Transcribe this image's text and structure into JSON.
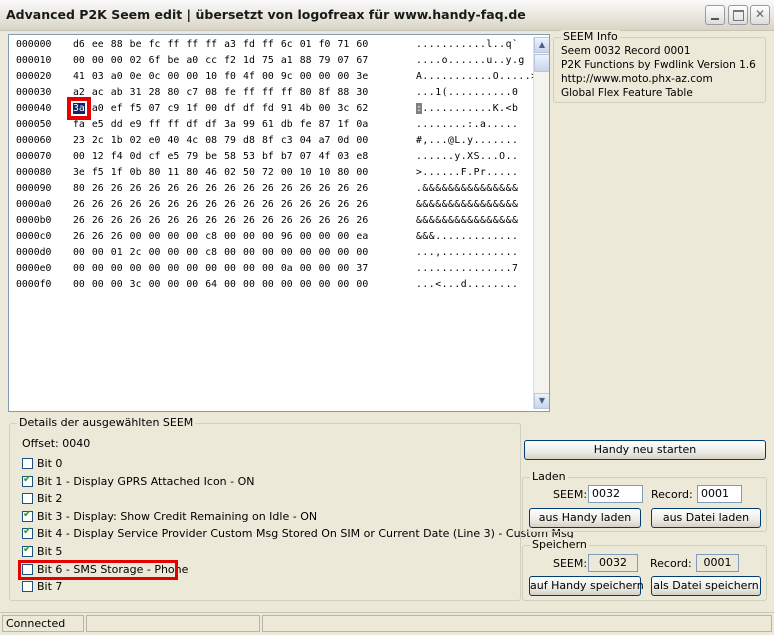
{
  "window": {
    "title": "Advanced P2K Seem edit | übersetzt von logofreax für www.handy-faq.de",
    "buttons": [
      "minimize",
      "maximize",
      "close"
    ]
  },
  "hex_view": {
    "rows": [
      {
        "offset": "000000",
        "bytes": "d6 ee 88 be fc ff ff ff a3 fd ff 6c 01 f0 71 60",
        "ascii": "...........l..q`"
      },
      {
        "offset": "000010",
        "bytes": "00 00 00 02 6f be a0 cc f2 1d 75 a1 88 79 07 67",
        "ascii": "....o......u..y.g"
      },
      {
        "offset": "000020",
        "bytes": "41 03 a0 0e 0c 00 00 10 f0 4f 00 9c 00 00 00 3e",
        "ascii": "A...........O.....>"
      },
      {
        "offset": "000030",
        "bytes": "a2 ac ab 31 28 80 c7 08 fe ff ff ff 80 8f 88 30",
        "ascii": "...1(..........0"
      },
      {
        "offset": "000040",
        "sel_byte": "3a",
        "bytes": " a0 ef f5 07 c9 1f 00 df df fd 91 4b 00 3c 62",
        "sel_char": ":",
        "ascii": "...........K.<b"
      },
      {
        "offset": "000050",
        "bytes": "fa e5 dd e9 ff ff df df 3a 99 61 db fe 87 1f 0a",
        "ascii": "........:.a....."
      },
      {
        "offset": "000060",
        "bytes": "23 2c 1b 02 e0 40 4c 08 79 d8 8f c3 04 a7 0d 00",
        "ascii": "#,...@L.y......."
      },
      {
        "offset": "000070",
        "bytes": "00 12 f4 0d cf e5 79 be 58 53 bf b7 07 4f 03 e8",
        "ascii": "......y.XS...O.."
      },
      {
        "offset": "000080",
        "bytes": "3e f5 1f 0b 80 11 80 46 02 50 72 00 10 10 80 00",
        "ascii": ">......F.Pr....."
      },
      {
        "offset": "000090",
        "bytes": "80 26 26 26 26 26 26 26 26 26 26 26 26 26 26 26",
        "ascii": ".&&&&&&&&&&&&&&&"
      },
      {
        "offset": "0000a0",
        "bytes": "26 26 26 26 26 26 26 26 26 26 26 26 26 26 26 26",
        "ascii": "&&&&&&&&&&&&&&&&"
      },
      {
        "offset": "0000b0",
        "bytes": "26 26 26 26 26 26 26 26 26 26 26 26 26 26 26 26",
        "ascii": "&&&&&&&&&&&&&&&&"
      },
      {
        "offset": "0000c0",
        "bytes": "26 26 26 00 00 00 00 c8 00 00 00 96 00 00 00 ea",
        "ascii": "&&&............."
      },
      {
        "offset": "0000d0",
        "bytes": "00 00 01 2c 00 00 00 c8 00 00 00 00 00 00 00 00",
        "ascii": "...,............"
      },
      {
        "offset": "0000e0",
        "bytes": "00 00 00 00 00 00 00 00 00 00 00 0a 00 00 00 37",
        "ascii": "...............7"
      },
      {
        "offset": "0000f0",
        "bytes": "00 00 00 3c 00 00 00 64 00 00 00 00 00 00 00 00",
        "ascii": "...<...d........"
      }
    ]
  },
  "seem_info": {
    "legend": "SEEM Info",
    "lines": [
      "Seem 0032 Record 0001",
      "P2K Functions by Fwdlink Version 1.6",
      "http://www.moto.phx-az.com",
      "Global Flex Feature Table"
    ]
  },
  "details": {
    "legend": "Details der ausgewählten SEEM",
    "offset": "Offset: 0040",
    "bits": [
      {
        "label": "Bit 0",
        "checked": false
      },
      {
        "label": "Bit 1 - Display GPRS Attached Icon - ON",
        "checked": true
      },
      {
        "label": "Bit 2",
        "checked": false
      },
      {
        "label": "Bit 3 - Display: Show Credit Remaining on Idle - ON",
        "checked": true
      },
      {
        "label": "Bit 4 - Display Service Provider Custom Msg Stored On SIM or Current Date (Line 3) - Custom Msg",
        "checked": true
      },
      {
        "label": "Bit 5",
        "checked": true
      },
      {
        "label": "Bit 6 - SMS Storage - Phone",
        "checked": false
      },
      {
        "label": "Bit 7",
        "checked": false
      }
    ]
  },
  "restart_button": "Handy neu starten",
  "laden": {
    "legend": "Laden",
    "seem_label": "SEEM:",
    "seem_value": "0032",
    "record_label": "Record:",
    "record_value": "0001",
    "btn_handy": "aus Handy laden",
    "btn_datei": "aus Datei laden"
  },
  "speichern": {
    "legend": "Speichern",
    "seem_label": "SEEM:",
    "seem_value": "0032",
    "record_label": "Record:",
    "record_value": "0001",
    "btn_handy": "auf Handy speichern",
    "btn_datei": "als Datei speichern"
  },
  "status": {
    "text": "Connected"
  }
}
